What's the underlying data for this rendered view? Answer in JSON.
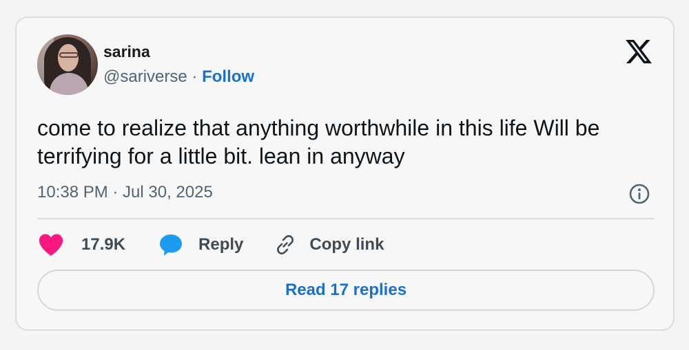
{
  "author": {
    "name": "sarina",
    "handle": "@sariverse",
    "separator": "·",
    "follow_label": "Follow"
  },
  "tweet": {
    "text": "come to realize that anything worthwhile in this life Will be terrifying for a little bit. lean in anyway",
    "timestamp": "10:38 PM · Jul 30, 2025"
  },
  "actions": {
    "likes": "17.9K",
    "reply_label": "Reply",
    "copy_link_label": "Copy link"
  },
  "read_replies_label": "Read 17 replies",
  "icons": {
    "logo": "x-logo-icon",
    "info": "info-icon",
    "like": "heart-icon",
    "reply": "speech-bubble-icon",
    "copy": "link-icon"
  },
  "colors": {
    "link_blue": "#1d70c9",
    "heart_pink": "#f91880",
    "reply_blue": "#1d9bf0",
    "muted_text": "#536471"
  }
}
